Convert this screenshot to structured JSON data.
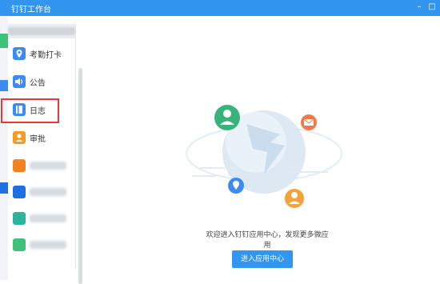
{
  "window": {
    "title": "钉钉工作台",
    "minimize_label": "–",
    "maximize_label": "□"
  },
  "sidebar": {
    "items": [
      {
        "label": "考勤打卡",
        "icon": "location-pin-icon",
        "color": "#3c8cf0"
      },
      {
        "label": "公告",
        "icon": "speaker-icon",
        "color": "#3c8cf0"
      },
      {
        "label": "日志",
        "icon": "journal-icon",
        "color": "#3c8cf0"
      },
      {
        "label": "审批",
        "icon": "person-approval-icon",
        "color": "#f39b22"
      },
      {
        "label": "",
        "icon": "app-icon",
        "color": "#f58220"
      },
      {
        "label": "",
        "icon": "app-icon",
        "color": "#1f6fe0"
      },
      {
        "label": "",
        "icon": "app-icon",
        "color": "#2bb5a1"
      },
      {
        "label": "",
        "icon": "app-icon",
        "color": "#3cc27a"
      }
    ]
  },
  "main": {
    "welcome_text": "欢迎进入钉钉应用中心，发现更多微应用",
    "enter_button": "进入应用中心"
  },
  "colors": {
    "brand_blue": "#3295f0",
    "highlight_red": "#e53935",
    "green_person": "#39b37b",
    "orange_mail": "#f07a4a",
    "orange_person": "#f5a23a"
  }
}
